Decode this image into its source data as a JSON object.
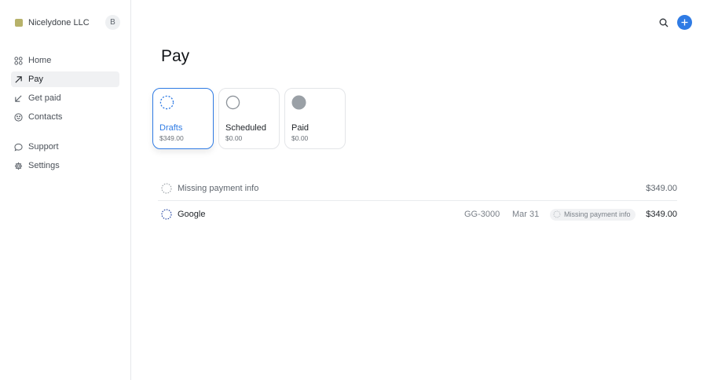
{
  "org": {
    "name": "Nicelydone LLC",
    "avatar_initial": "B"
  },
  "nav": {
    "primary": [
      {
        "label": "Home",
        "icon": "grid-icon"
      },
      {
        "label": "Pay",
        "icon": "arrow-up-right-icon",
        "active": true
      },
      {
        "label": "Get paid",
        "icon": "arrow-down-left-icon"
      },
      {
        "label": "Contacts",
        "icon": "smiley-icon"
      }
    ],
    "secondary": [
      {
        "label": "Support",
        "icon": "chat-bubble-icon"
      },
      {
        "label": "Settings",
        "icon": "gear-icon"
      }
    ]
  },
  "header": {
    "search_icon": "search-icon",
    "add_icon": "plus-icon"
  },
  "page": {
    "title": "Pay"
  },
  "status_cards": [
    {
      "label": "Drafts",
      "amount": "$349.00",
      "selected": true,
      "icon": "dashed-circle-icon"
    },
    {
      "label": "Scheduled",
      "amount": "$0.00",
      "icon": "empty-circle-icon"
    },
    {
      "label": "Paid",
      "amount": "$0.00",
      "icon": "filled-circle-icon"
    }
  ],
  "groups": [
    {
      "label": "Missing payment info",
      "total": "$349.00",
      "bills": [
        {
          "name": "Google",
          "invoice": "GG-3000",
          "date": "Mar 31",
          "status": "Missing payment info",
          "amount": "$349.00"
        }
      ]
    }
  ],
  "colors": {
    "accent": "#2f7be4",
    "org_swatch": "#b7b26a",
    "paid_fill": "#9aa0a6"
  }
}
